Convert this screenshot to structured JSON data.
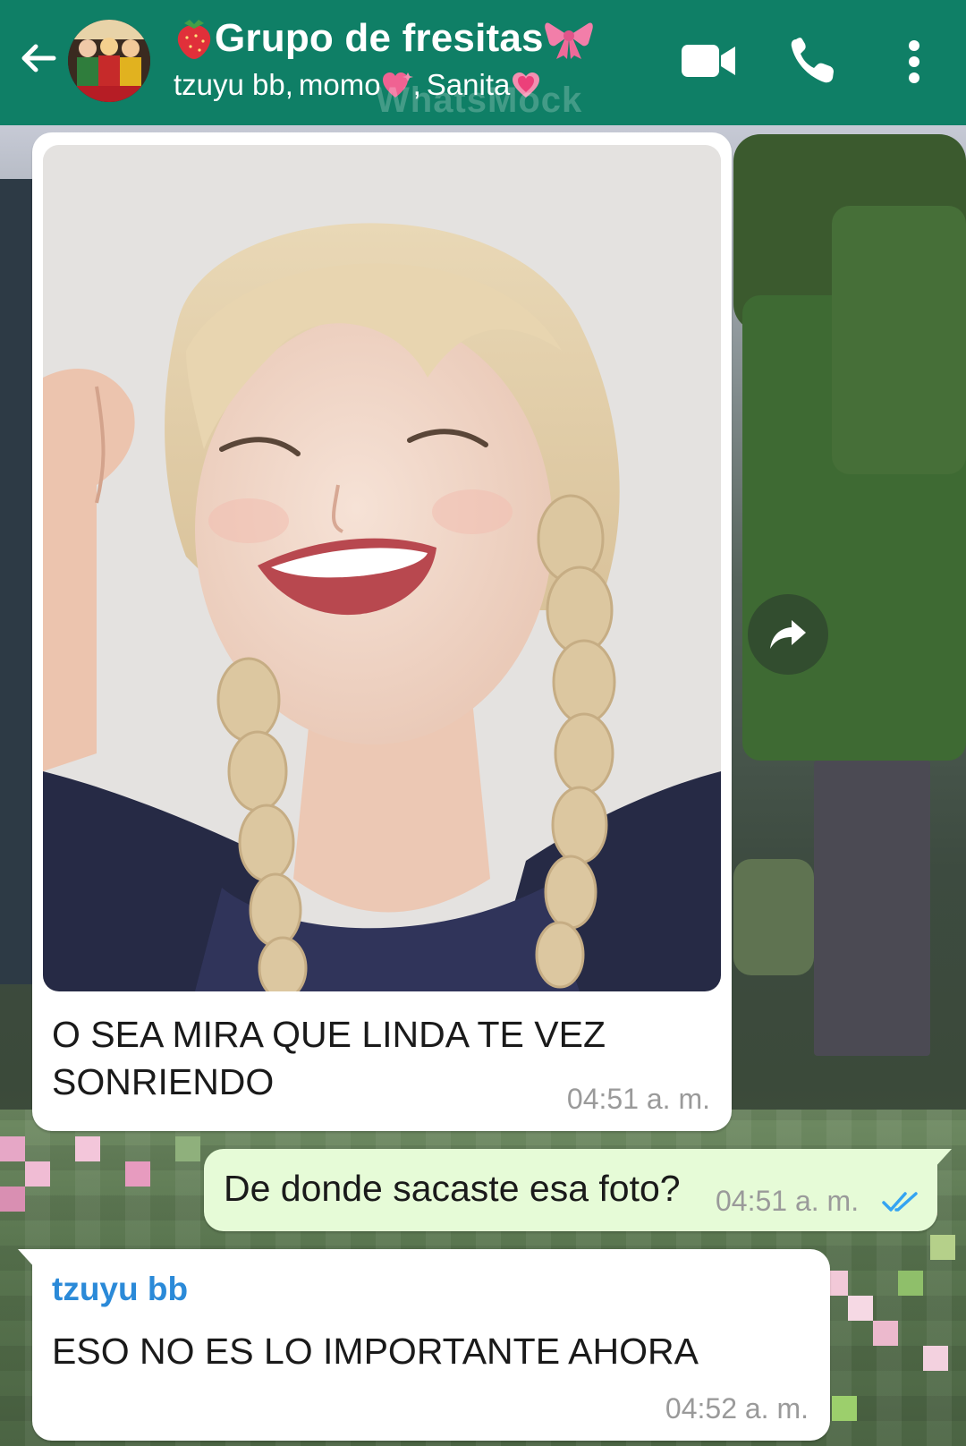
{
  "header": {
    "title": "Grupo de fresitas",
    "title_prefix_emoji": "strawberry-emoji",
    "title_suffix_emoji": "pink-bow-emoji",
    "members": [
      "tzuyu bb",
      "momo",
      "Sanita"
    ],
    "member_emojis": [
      "",
      "heart-with-sparkles-emoji",
      "growing-heart-emoji"
    ],
    "watermark": "WhatsMock",
    "icons": [
      "back-arrow-icon",
      "video-call-icon",
      "voice-call-icon",
      "more-options-icon"
    ],
    "color": "#0f7f66"
  },
  "messages": [
    {
      "type": "image",
      "direction": "incoming",
      "image": "photo of smiling woman with blonde braids",
      "caption": "O SEA MIRA QUE LINDA TE VEZ SONRIENDO",
      "time": "04:51 a. m."
    },
    {
      "type": "text",
      "direction": "outgoing",
      "text": "De donde sacaste esa foto?",
      "time": "04:51 a. m.",
      "status": "read-double-check-icon"
    },
    {
      "type": "text",
      "direction": "incoming",
      "sender": "tzuyu bb",
      "sender_color": "#2b8ad8",
      "text": "ESO NO ES LO IMPORTANTE AHORA",
      "time": "04:52 a. m."
    }
  ],
  "colors": {
    "outgoing_bubble": "#e6fbd7",
    "incoming_bubble": "#ffffff",
    "read_ticks": "#34a4f2"
  }
}
